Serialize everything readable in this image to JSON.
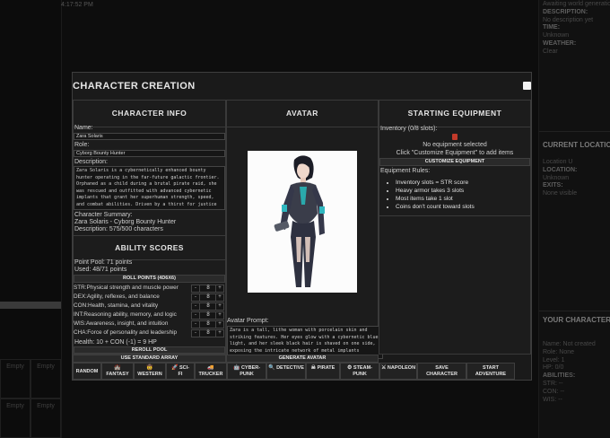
{
  "background": {
    "time": "4:17:52 PM",
    "left_slots": [
      "Empty",
      "Empty",
      "Empty",
      "Empty"
    ],
    "right_panel": {
      "top_lines": [
        {
          "text": "Awaiting world generation",
          "style": "v"
        },
        {
          "text": "DESCRIPTION:",
          "style": "k"
        },
        {
          "text": "No description yet",
          "style": "v"
        },
        {
          "text": "TIME:",
          "style": "k"
        },
        {
          "text": "Unknown",
          "style": "v"
        },
        {
          "text": "WEATHER:",
          "style": "k"
        },
        {
          "text": "Clear",
          "style": "v"
        }
      ],
      "location_heading": "CURRENT LOCATION",
      "location_lines": [
        {
          "text": "Location U",
          "style": "v"
        },
        {
          "text": "LOCATION:",
          "style": "k"
        },
        {
          "text": "Unknown",
          "style": "v"
        },
        {
          "text": "EXITS:",
          "style": "k"
        },
        {
          "text": "None visible",
          "style": "v"
        }
      ],
      "character_heading": "YOUR CHARACTER",
      "character_lines": [
        {
          "text": "Name: Not created",
          "style": "v"
        },
        {
          "text": "Role: None",
          "style": "v"
        },
        {
          "text": "Level: 1",
          "style": "v"
        },
        {
          "text": "HP: 0/0",
          "style": "v"
        },
        {
          "text": "ABILITIES:",
          "style": "k"
        },
        {
          "text": "STR: --",
          "style": "v"
        },
        {
          "text": "CON: --",
          "style": "v"
        },
        {
          "text": "WIS: --",
          "style": "v"
        }
      ]
    }
  },
  "modal": {
    "title": "CHARACTER CREATION",
    "info": {
      "heading": "CHARACTER INFO",
      "name_label": "Name:",
      "name_value": "Zara Solaris",
      "role_label": "Role:",
      "role_value": "Cyborg Bounty Hunter",
      "description_label": "Description:",
      "description_text": "Zara Solaris is a cybernetically enhanced bounty\nhunter operating in the far-future galactic frontier.\nOrphaned as a child during a brutal pirate raid, she\nwas rescued and outfitted with advanced cybernetic\nimplants that grant her superhuman strength, speed,\nand combat abilities. Driven by a thirst for justice",
      "summary_label": "Character Summary:",
      "summary_line": "Zara Solaris - Cyborg Bounty Hunter",
      "summary_desc": "Description: 575/500 characters"
    },
    "abilities": {
      "heading": "ABILITY SCORES",
      "point_pool": "Point Pool: 71 points",
      "used": "Used: 48/71 points",
      "roll_button": "ROLL POINTS (4D6X6)",
      "stats": [
        {
          "label": "STR:Physical strength and muscle power",
          "value": "8"
        },
        {
          "label": "DEX:Agility, reflexes, and balance",
          "value": "8"
        },
        {
          "label": "CON:Health, stamina, and vitality",
          "value": "8"
        },
        {
          "label": "INT:Reasoning ability, memory, and logic",
          "value": "8"
        },
        {
          "label": "WIS:Awareness, insight, and intuition",
          "value": "8"
        },
        {
          "label": "CHA:Force of personality and leadership",
          "value": "8"
        }
      ],
      "minus": "-",
      "plus": "+",
      "health": "Health: 10 + CON (-1) = 9 HP",
      "reroll_button": "REROLL POOL",
      "standard_button": "USE STANDARD ARRAY"
    },
    "avatar": {
      "heading": "AVATAR",
      "prompt_label": "Avatar Prompt:",
      "prompt_text": "Zara is a tall, lithe woman with porcelain skin and\nstriking features. Her eyes glow with a cybernetic blue\nlight, and her sleek black hair is shaved on one side,\nexposing the intricate network of metal implants",
      "generate_button": "GENERATE AVATAR"
    },
    "equipment": {
      "heading": "STARTING EQUIPMENT",
      "inventory_label": "Inventory (0/8 slots):",
      "none_selected": "No equipment selected",
      "hint": "Click \"Customize Equipment\" to add items",
      "customize_button": "CUSTOMIZE EQUIPMENT",
      "rules_label": "Equipment Rules:",
      "rules": [
        "Inventory slots = STR score",
        "Heavy armor takes 3 slots",
        "Most items take 1 slot",
        "Coins don't count toward slots"
      ]
    },
    "bottom_buttons": [
      {
        "icon": "",
        "lines": [
          "RANDOM"
        ]
      },
      {
        "icon": "🏰",
        "lines": [
          "FANTASY"
        ]
      },
      {
        "icon": "🤠",
        "lines": [
          "WESTERN"
        ]
      },
      {
        "icon": "🚀",
        "lines": [
          "SCI-",
          "FI"
        ]
      },
      {
        "icon": "🚚",
        "lines": [
          "TRUCKER"
        ]
      },
      {
        "icon": "🤖",
        "lines": [
          "CYBER-",
          "PUNK"
        ]
      },
      {
        "icon": "🔍",
        "lines": [
          "DETECTIVE"
        ]
      },
      {
        "icon": "☠",
        "lines": [
          "PIRATE"
        ]
      },
      {
        "icon": "⚙",
        "lines": [
          "STEAM-",
          "PUNK"
        ]
      },
      {
        "icon": "⚔",
        "lines": [
          "NAPOLEON"
        ]
      },
      {
        "icon": "",
        "lines": [
          "SAVE",
          "CHARACTER"
        ]
      },
      {
        "icon": "",
        "lines": [
          "START",
          "ADVENTURE"
        ]
      }
    ]
  }
}
